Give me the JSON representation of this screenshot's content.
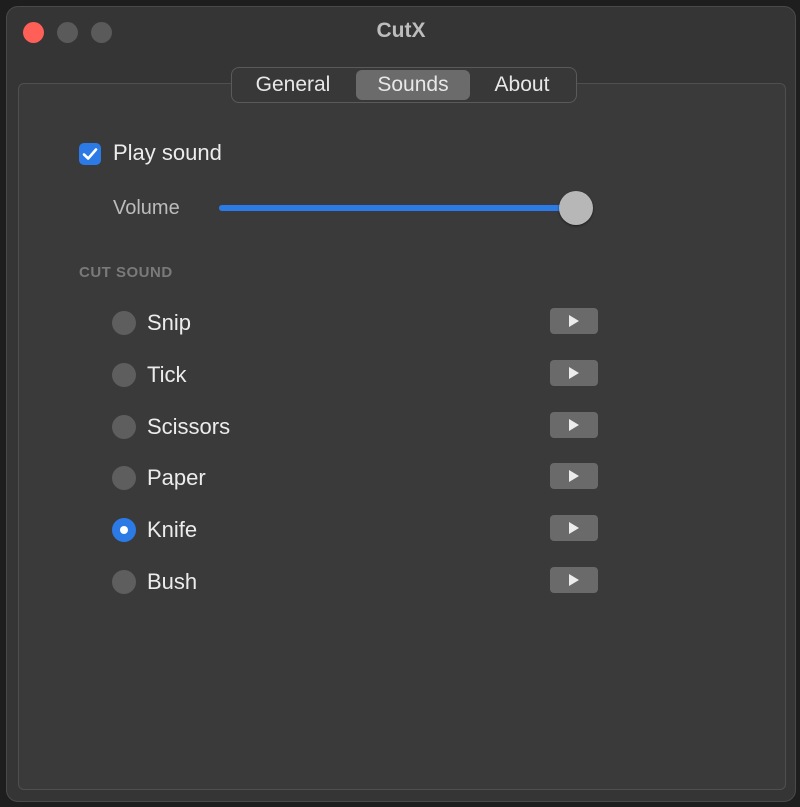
{
  "window": {
    "title": "CutX"
  },
  "tabs": [
    {
      "label": "General",
      "selected": false
    },
    {
      "label": "Sounds",
      "selected": true
    },
    {
      "label": "About",
      "selected": false
    }
  ],
  "sound_settings": {
    "play_sound_label": "Play sound",
    "play_sound_checked": true,
    "volume_label": "Volume",
    "volume_value": 1.0,
    "cut_sound_header": "CUT SOUND",
    "sounds": [
      {
        "label": "Snip",
        "selected": false,
        "play_icon": "play-icon"
      },
      {
        "label": "Tick",
        "selected": false,
        "play_icon": "play-icon"
      },
      {
        "label": "Scissors",
        "selected": false,
        "play_icon": "play-icon"
      },
      {
        "label": "Paper",
        "selected": false,
        "play_icon": "play-icon"
      },
      {
        "label": "Knife",
        "selected": true,
        "play_icon": "play-icon"
      },
      {
        "label": "Bush",
        "selected": false,
        "play_icon": "play-icon"
      }
    ]
  },
  "colors": {
    "accent": "#2c7ae6",
    "close_button": "#fe5f57",
    "window_background": "#353535"
  }
}
